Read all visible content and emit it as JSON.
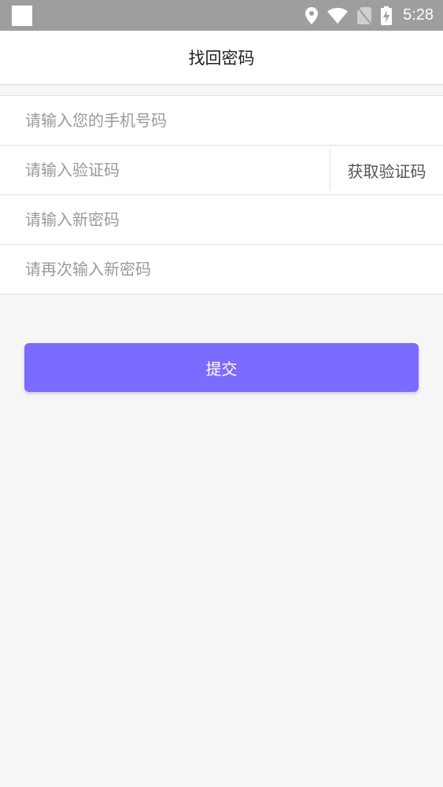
{
  "status_bar": {
    "time": "5:28",
    "icons": [
      "notification-square-icon",
      "location-icon",
      "wifi-icon",
      "no-sim-icon",
      "battery-charging-icon"
    ]
  },
  "header": {
    "title": "找回密码"
  },
  "form": {
    "phone_placeholder": "请输入您的手机号码",
    "code_placeholder": "请输入验证码",
    "get_code_label": "获取验证码",
    "new_password_placeholder": "请输入新密码",
    "confirm_password_placeholder": "请再次输入新密码"
  },
  "submit": {
    "label": "提交"
  },
  "colors": {
    "accent": "#7b6bff",
    "status_bar": "#9e9e9e",
    "background": "#f6f6f6"
  }
}
